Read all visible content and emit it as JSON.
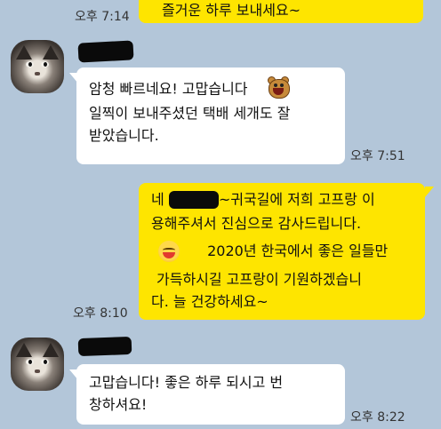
{
  "messages": [
    {
      "id": "m0",
      "direction": "out",
      "time": "오후 7:14",
      "lines": [
        "즐거운 하루 보내세요~"
      ]
    },
    {
      "id": "m1",
      "direction": "in",
      "time": "오후 7:51",
      "lines": [
        "암청 빠르네요! 고맙습니다",
        "일찍이 보내주셨던 택배 세개도 잘",
        "받았습니다."
      ],
      "emoji": "bear-emoticon"
    },
    {
      "id": "m2",
      "direction": "out",
      "time": "오후 8:10",
      "lines": [
        "네 ",
        "~귀국길에 저희 고프랑 이",
        "용해주셔서 진심으로 감사드립니다.",
        "2020년 한국에서 좋은 일들만",
        "가득하시길 고프랑이 기원하겠습니",
        "다. 늘 건강하세요~"
      ],
      "emoji": "laughing-face-emoji"
    },
    {
      "id": "m3",
      "direction": "in",
      "time": "오후 8:22",
      "lines": [
        "고맙습니다! 좋은 하루 되시고 번",
        "창하셔요!"
      ]
    }
  ],
  "icons": {
    "avatar": "cat-avatar-icon",
    "redaction": "redacted-name"
  },
  "colors": {
    "background": "#b3c6d9",
    "incoming_bubble": "#ffffff",
    "outgoing_bubble": "#fee500"
  }
}
